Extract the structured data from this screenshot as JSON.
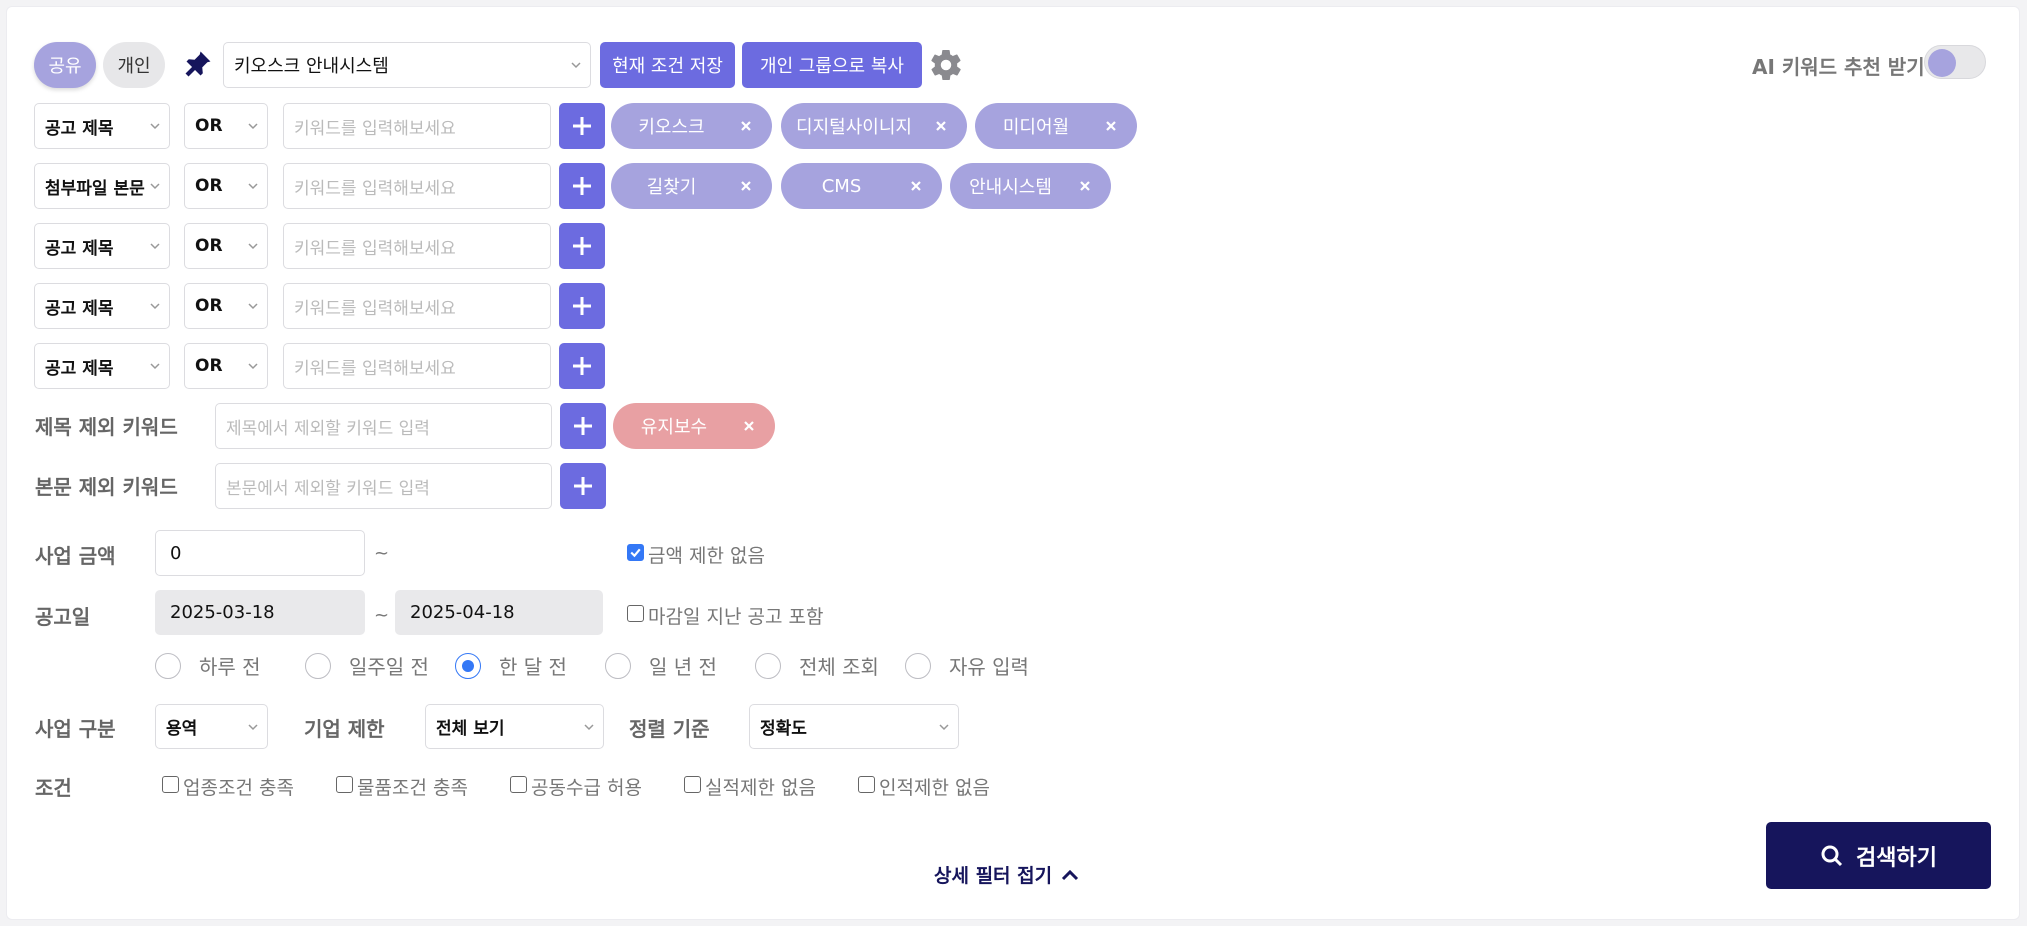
{
  "header": {
    "scope_tabs": [
      "공유",
      "개인"
    ],
    "group_select": "키오스크 안내시스템",
    "save_button": "현재 조건 저장",
    "copy_button": "개인 그룹으로 복사",
    "ai_label": "AI 키워드 추천 받기",
    "ai_toggle_on": false
  },
  "keyword_rows": [
    {
      "field": "공고 제목",
      "op": "OR",
      "placeholder": "키워드를 입력해보세요",
      "chips": [
        "키오스크",
        "디지털사이니지",
        "미디어월"
      ]
    },
    {
      "field": "첨부파일 본문",
      "op": "OR",
      "placeholder": "키워드를 입력해보세요",
      "chips": [
        "길찾기",
        "CMS",
        "안내시스템"
      ]
    },
    {
      "field": "공고 제목",
      "op": "OR",
      "placeholder": "키워드를 입력해보세요",
      "chips": []
    },
    {
      "field": "공고 제목",
      "op": "OR",
      "placeholder": "키워드를 입력해보세요",
      "chips": []
    },
    {
      "field": "공고 제목",
      "op": "OR",
      "placeholder": "키워드를 입력해보세요",
      "chips": []
    }
  ],
  "exclude_title": {
    "label": "제목 제외 키워드",
    "placeholder": "제목에서 제외할 키워드 입력",
    "chips": [
      "유지보수"
    ]
  },
  "exclude_body": {
    "label": "본문 제외 키워드",
    "placeholder": "본문에서 제외할 키워드 입력",
    "chips": []
  },
  "amount": {
    "label": "사업 금액",
    "min": "0",
    "tilde": "~",
    "no_limit_label": "금액 제한 없음",
    "no_limit_checked": true
  },
  "date": {
    "label": "공고일",
    "start": "2025-03-18",
    "end": "2025-04-18",
    "tilde": "~",
    "include_closed_label": "마감일 지난 공고 포함",
    "include_closed_checked": false
  },
  "period_options": [
    {
      "label": "하루 전",
      "selected": false
    },
    {
      "label": "일주일 전",
      "selected": false
    },
    {
      "label": "한 달 전",
      "selected": true
    },
    {
      "label": "일 년 전",
      "selected": false
    },
    {
      "label": "전체 조회",
      "selected": false
    },
    {
      "label": "자유 입력",
      "selected": false
    }
  ],
  "business_type": {
    "label": "사업 구분",
    "value": "용역"
  },
  "company_limit": {
    "label": "기업 제한",
    "value": "전체 보기"
  },
  "sort": {
    "label": "정렬 기준",
    "value": "정확도"
  },
  "conditions": {
    "label": "조건",
    "options": [
      "업종조건 충족",
      "물품조건 충족",
      "공동수급 허용",
      "실적제한 없음",
      "인적제한 없음"
    ]
  },
  "collapse_label": "상세 필터 접기",
  "search_button": "검색하기",
  "colors": {
    "accent": "#6c6be0",
    "chip": "#a6a3de",
    "exclude_chip": "#e8a0a3",
    "search_bg": "#16155c"
  }
}
